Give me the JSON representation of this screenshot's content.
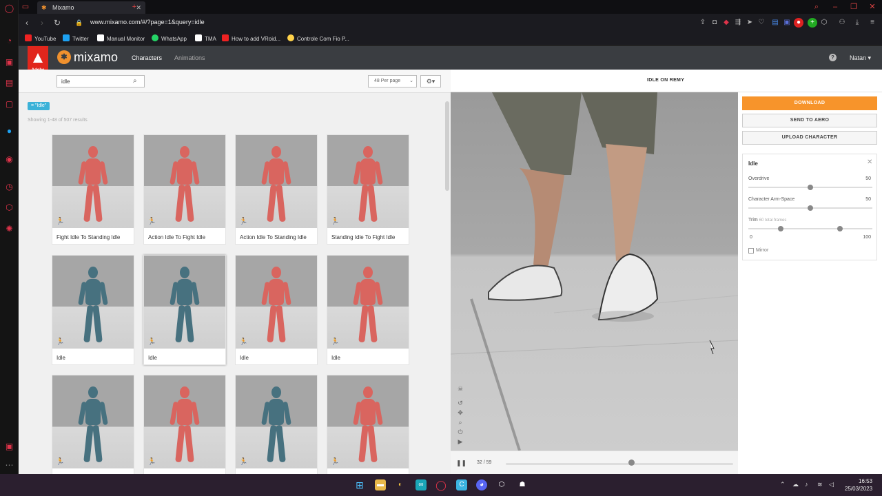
{
  "browser": {
    "tab_title": "Mixamo",
    "url": "www.mixamo.com/#/?page=1&query=idle",
    "bookmarks": [
      "YouTube",
      "Twitter",
      "Manual Monitor",
      "WhatsApp",
      "TMA",
      "How to add VRoid...",
      "Controle Com Fio P..."
    ]
  },
  "header": {
    "adobe_label": "Adobe",
    "logo": "mixamo",
    "nav": [
      "Characters",
      "Animations"
    ],
    "user": "Natan ▾"
  },
  "search": {
    "value": "idle",
    "per_page": "48 Per page",
    "filter_tag": "= \"Idle\"",
    "results": "Showing 1-48 of 507 results"
  },
  "cards": [
    {
      "label": "Fight Idle To Standing Idle",
      "color": "red"
    },
    {
      "label": "Action Idle To Fight Idle",
      "color": "red"
    },
    {
      "label": "Action Idle To Standing Idle",
      "color": "red"
    },
    {
      "label": "Standing Idle To Fight Idle",
      "color": "red"
    },
    {
      "label": "Idle",
      "color": "blue"
    },
    {
      "label": "Idle",
      "color": "blue",
      "selected": true
    },
    {
      "label": "Idle",
      "color": "red"
    },
    {
      "label": "Idle",
      "color": "red"
    },
    {
      "label": "",
      "color": "blue"
    },
    {
      "label": "",
      "color": "red"
    },
    {
      "label": "",
      "color": "blue"
    },
    {
      "label": "",
      "color": "red"
    }
  ],
  "preview": {
    "title": "IDLE ON REMY",
    "frame": "32 / 59",
    "progress": 0.55
  },
  "actions": {
    "download": "DOWNLOAD",
    "send": "SEND TO AERO",
    "upload": "UPLOAD CHARACTER"
  },
  "settings": {
    "title": "Idle",
    "overdrive_label": "Overdrive",
    "overdrive_value": "50",
    "armspace_label": "Character Arm-Space",
    "armspace_value": "50",
    "trim_label": "Trim",
    "trim_sub": "60 total frames",
    "trim_min": "0",
    "trim_max": "100",
    "mirror_label": "Mirror"
  },
  "clock": {
    "time": "16:53",
    "date": "25/03/2023"
  }
}
